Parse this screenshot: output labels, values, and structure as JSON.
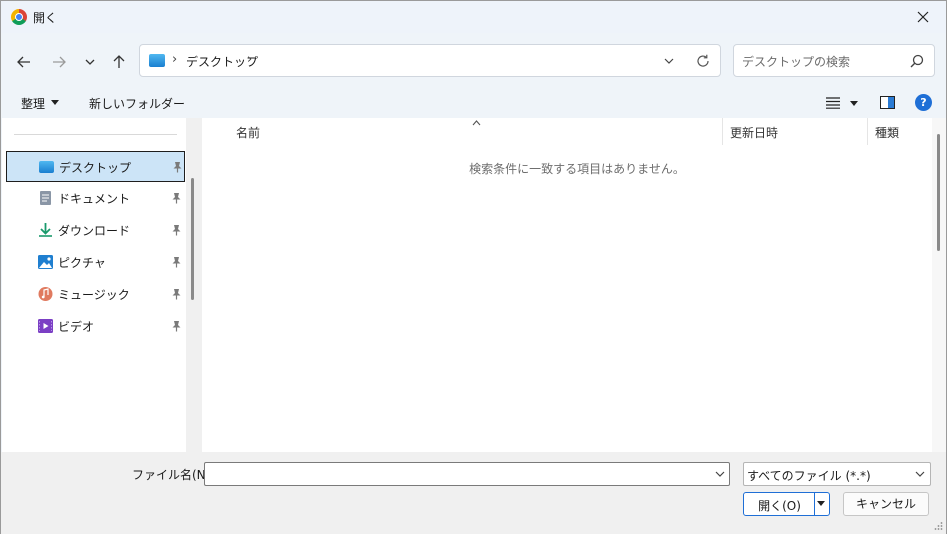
{
  "window": {
    "title": "開く",
    "close_label": "閉じる"
  },
  "address": {
    "location": "デスクトップ",
    "separator": "›"
  },
  "search": {
    "placeholder": "デスクトップの検索"
  },
  "commands": {
    "organize": "整理",
    "new_folder": "新しいフォルダー"
  },
  "nav_items": [
    {
      "label": "デスクトップ",
      "icon": "desktop-icon",
      "selected": true
    },
    {
      "label": "ドキュメント",
      "icon": "documents-icon"
    },
    {
      "label": "ダウンロード",
      "icon": "downloads-icon"
    },
    {
      "label": "ピクチャ",
      "icon": "pictures-icon"
    },
    {
      "label": "ミュージック",
      "icon": "music-icon"
    },
    {
      "label": "ビデオ",
      "icon": "videos-icon"
    }
  ],
  "columns": {
    "name": "名前",
    "modified": "更新日時",
    "type": "種類"
  },
  "empty_message": "検索条件に一致する項目はありません。",
  "filename": {
    "label": "ファイル名(N):",
    "value": ""
  },
  "filter": {
    "selected": "すべてのファイル (*.*)"
  },
  "buttons": {
    "open": "開く(O)",
    "cancel": "キャンセル"
  },
  "colors": {
    "accent": "#1f6fd6",
    "selection": "#cce4f7"
  }
}
